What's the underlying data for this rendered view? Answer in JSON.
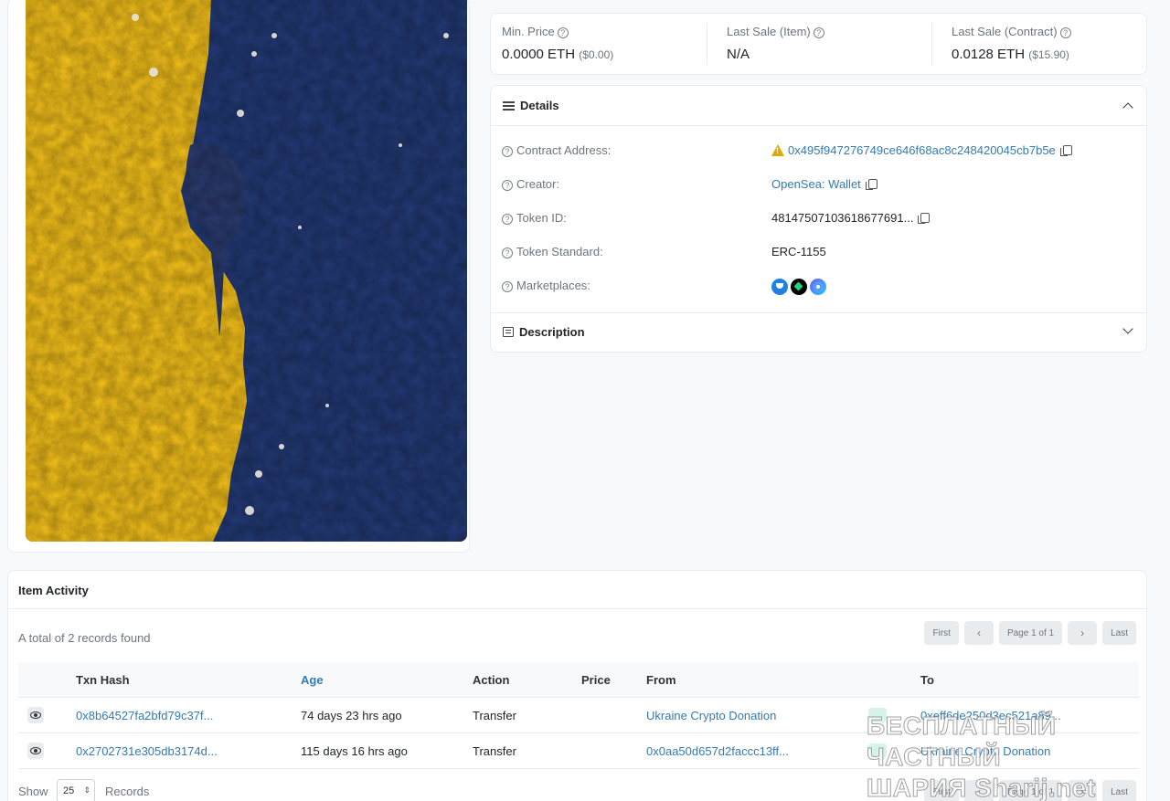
{
  "price_summary": {
    "min_price": {
      "label": "Min. Price",
      "value": "0.0000 ETH",
      "usd": "($0.00)"
    },
    "last_sale_item": {
      "label": "Last Sale (Item)",
      "value": "N/A"
    },
    "last_sale_contract": {
      "label": "Last Sale (Contract)",
      "value": "0.0128 ETH",
      "usd": "($15.90)"
    }
  },
  "details": {
    "title": "Details",
    "rows": {
      "contract_address": {
        "label": "Contract Address:",
        "value": "0x495f947276749ce646f68ac8c248420045cb7b5e"
      },
      "creator": {
        "label": "Creator:",
        "value": "OpenSea: Wallet"
      },
      "token_id": {
        "label": "Token ID:",
        "value": "48147507103618677691..."
      },
      "token_standard": {
        "label": "Token Standard:",
        "value": "ERC-1155"
      },
      "marketplaces": {
        "label": "Marketplaces:",
        "icons": [
          "opensea-icon",
          "blur-icon",
          "looksrare-icon"
        ]
      }
    }
  },
  "description": {
    "title": "Description"
  },
  "activity": {
    "title": "Item Activity",
    "total": "A total of 2 records found",
    "pager": {
      "first": "First",
      "prev": "‹",
      "page": "Page 1 of 1",
      "next": "›",
      "last": "Last"
    },
    "columns": {
      "txn_hash": "Txn Hash",
      "age": "Age",
      "action": "Action",
      "price": "Price",
      "from": "From",
      "to": "To"
    },
    "rows": [
      {
        "txn_hash": "0x8b64527fa2bfd79c37f...",
        "age": "74 days 23 hrs ago",
        "action": "Transfer",
        "price": "",
        "from": "Ukraine Crypto Donation",
        "to": "0xeff6de250d3ec521a89..."
      },
      {
        "txn_hash": "0x2702731e305db3174d...",
        "age": "115 days 16 hrs ago",
        "action": "Transfer",
        "price": "",
        "from": "0x0aa50d657d2faccc13ff...",
        "to": "Ukraine Crypto Donation"
      }
    ],
    "show_label": "Show",
    "page_size": "25",
    "records_label": "Records"
  },
  "watermark": {
    "line1": "БЕСПЛАТНЫЙ ЧАСТНЫЙ",
    "line2": "ШАРИЯ Sharij.net"
  },
  "colors": {
    "link": "#357ab0",
    "artwork_yellow": "#f6c21a",
    "artwork_blue": "#233a77"
  }
}
